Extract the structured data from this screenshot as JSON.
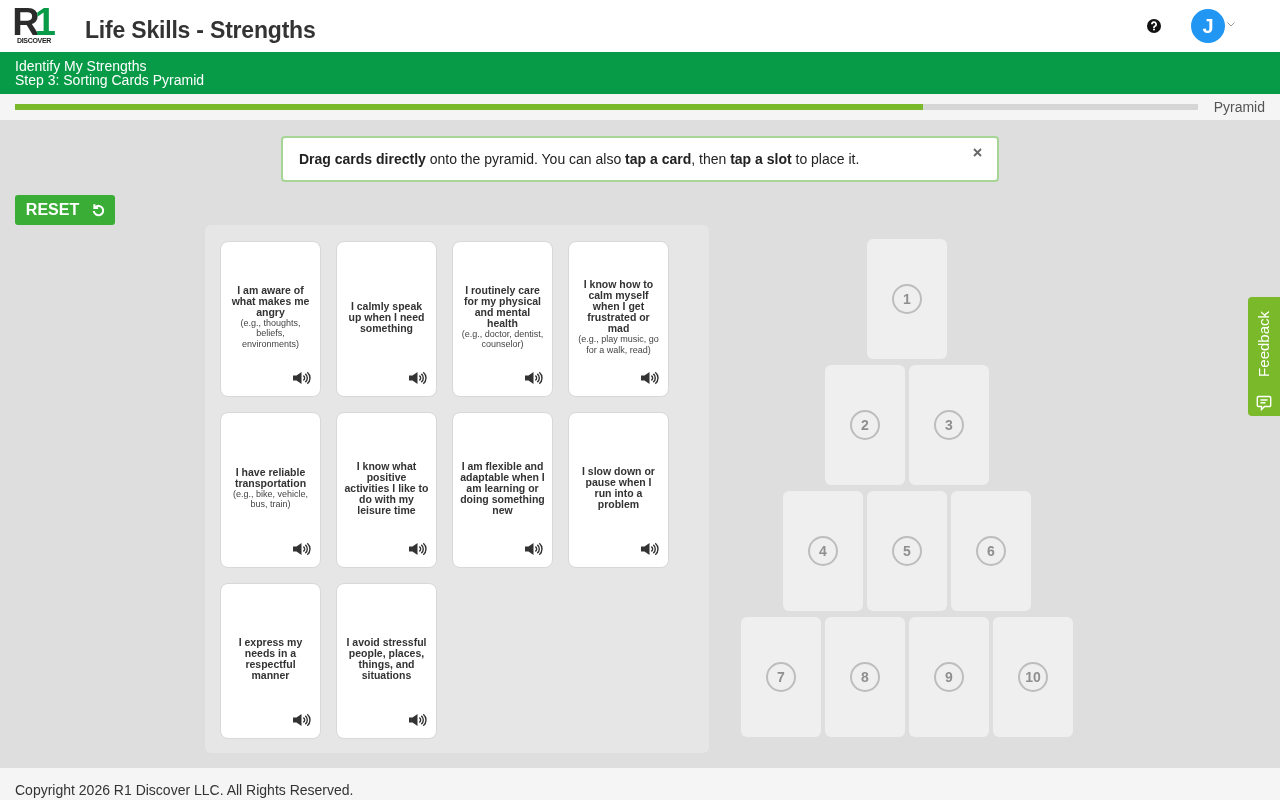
{
  "header": {
    "logo": {
      "mark": [
        "R",
        "1"
      ],
      "wordmark": "DISCOVER"
    },
    "title": "Life Skills - Strengths",
    "avatar": {
      "initial": "J"
    }
  },
  "banner": {
    "activity": "Identify My Strengths",
    "step": "Step 3: Sorting Cards Pyramid"
  },
  "progress": {
    "level": 0.768,
    "label": "Pyramid"
  },
  "notice": {
    "text": "**Drag cards directly** onto the pyramid. You can also **tap a card**, then **tap a slot** to place it."
  },
  "reset_button": {
    "label": "RESET"
  },
  "cards": [
    {
      "statement": "I am aware of what makes me angry",
      "example": "(e.g., thoughts, beliefs, environments)"
    },
    {
      "statement": "I calmly speak up when I need something"
    },
    {
      "statement": "I routinely care for my physical and mental health",
      "example": "(e.g., doctor, dentist, counselor)"
    },
    {
      "statement": "I know how to calm myself when I get frustrated or mad",
      "example": "(e.g., play music, go for a walk, read)"
    },
    {
      "statement": "I have reliable transportation",
      "example": "(e.g., bike, vehicle, bus, train)"
    },
    {
      "statement": "I know what positive activities I like to do with my leisure time"
    },
    {
      "statement": "I am flexible and adaptable when I am learning or doing something new"
    },
    {
      "statement": "I slow down or pause when I run into a problem"
    },
    {
      "statement": "I express my needs in a respectful manner"
    },
    {
      "statement": "I avoid stressful people, places, things, and situations"
    }
  ],
  "pyramid": {
    "rows": [
      [
        "1"
      ],
      [
        "2",
        "3"
      ],
      [
        "4",
        "5",
        "6"
      ],
      [
        "7",
        "8",
        "9",
        "10"
      ]
    ]
  },
  "feedback_tab": {
    "label": "Feedback"
  },
  "footer": {
    "text": "Copyright 2026 R1 Discover LLC. All Rights Reserved."
  }
}
